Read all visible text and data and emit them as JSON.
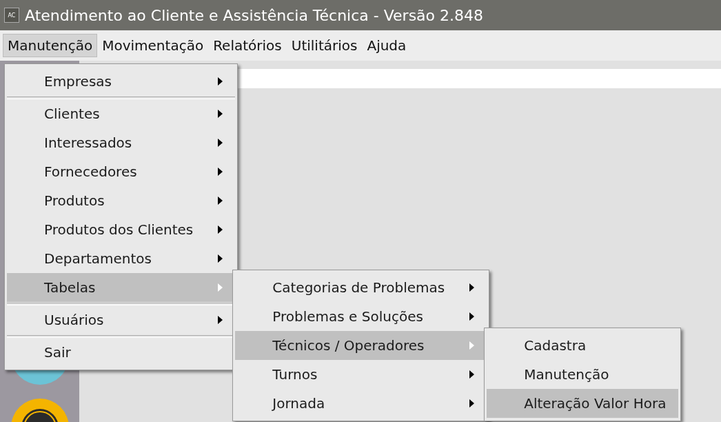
{
  "window": {
    "icon_text": "AC",
    "title": "Atendimento ao Cliente e Assistência Técnica - Versão 2.848"
  },
  "menubar": {
    "items": [
      {
        "label": "Manutenção",
        "selected": true,
        "menu": [
          {
            "kind": "item",
            "label": "Empresas",
            "selected": false,
            "has_submenu": true
          },
          {
            "kind": "separator"
          },
          {
            "kind": "item",
            "label": "Clientes",
            "selected": false,
            "has_submenu": true
          },
          {
            "kind": "item",
            "label": "Interessados",
            "selected": false,
            "has_submenu": true
          },
          {
            "kind": "item",
            "label": "Fornecedores",
            "selected": false,
            "has_submenu": true
          },
          {
            "kind": "item",
            "label": "Produtos",
            "selected": false,
            "has_submenu": true
          },
          {
            "kind": "item",
            "label": "Produtos dos Clientes",
            "selected": false,
            "has_submenu": true
          },
          {
            "kind": "item",
            "label": "Departamentos",
            "selected": false,
            "has_submenu": true
          },
          {
            "kind": "item",
            "label": "Tabelas",
            "selected": true,
            "has_submenu": true,
            "submenu": [
              {
                "kind": "item",
                "label": "Categorias de Problemas",
                "selected": false,
                "has_submenu": true
              },
              {
                "kind": "item",
                "label": "Problemas e Soluções",
                "selected": false,
                "has_submenu": true
              },
              {
                "kind": "item",
                "label": "Técnicos / Operadores",
                "selected": true,
                "has_submenu": true,
                "submenu": [
                  {
                    "kind": "item",
                    "label": "Cadastra",
                    "selected": false,
                    "has_submenu": false
                  },
                  {
                    "kind": "item",
                    "label": "Manutenção",
                    "selected": false,
                    "has_submenu": false
                  },
                  {
                    "kind": "item",
                    "label": "Alteração Valor Hora",
                    "selected": true,
                    "has_submenu": false
                  }
                ]
              },
              {
                "kind": "item",
                "label": "Turnos",
                "selected": false,
                "has_submenu": true
              },
              {
                "kind": "item",
                "label": "Jornada",
                "selected": false,
                "has_submenu": true
              }
            ]
          },
          {
            "kind": "separator"
          },
          {
            "kind": "item",
            "label": "Usuários",
            "selected": false,
            "has_submenu": true
          },
          {
            "kind": "separator"
          },
          {
            "kind": "item",
            "label": "Sair",
            "selected": false,
            "has_submenu": false
          }
        ]
      },
      {
        "label": "Movimentação",
        "selected": false
      },
      {
        "label": "Relatórios",
        "selected": false
      },
      {
        "label": "Utilitários",
        "selected": false
      },
      {
        "label": "Ajuda",
        "selected": false
      }
    ]
  }
}
